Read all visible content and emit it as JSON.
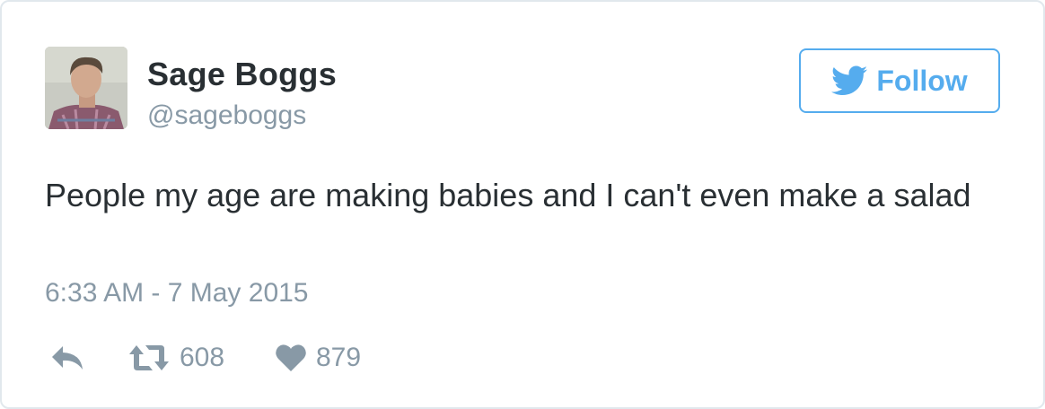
{
  "tweet": {
    "author_name": "Sage Boggs",
    "author_handle": "@sageboggs",
    "follow_label": "Follow",
    "text": "People my age are making babies and I can't even make a salad",
    "timestamp": "6:33 AM - 7 May 2015",
    "retweet_count": "608",
    "like_count": "879"
  },
  "icons": {
    "follow": "twitter-bird-icon",
    "reply": "reply-icon",
    "retweet": "retweet-icon",
    "like": "heart-icon"
  },
  "colors": {
    "accent": "#55acee",
    "text": "#292f33",
    "muted": "#8899a6",
    "border": "#e1e8ed"
  }
}
